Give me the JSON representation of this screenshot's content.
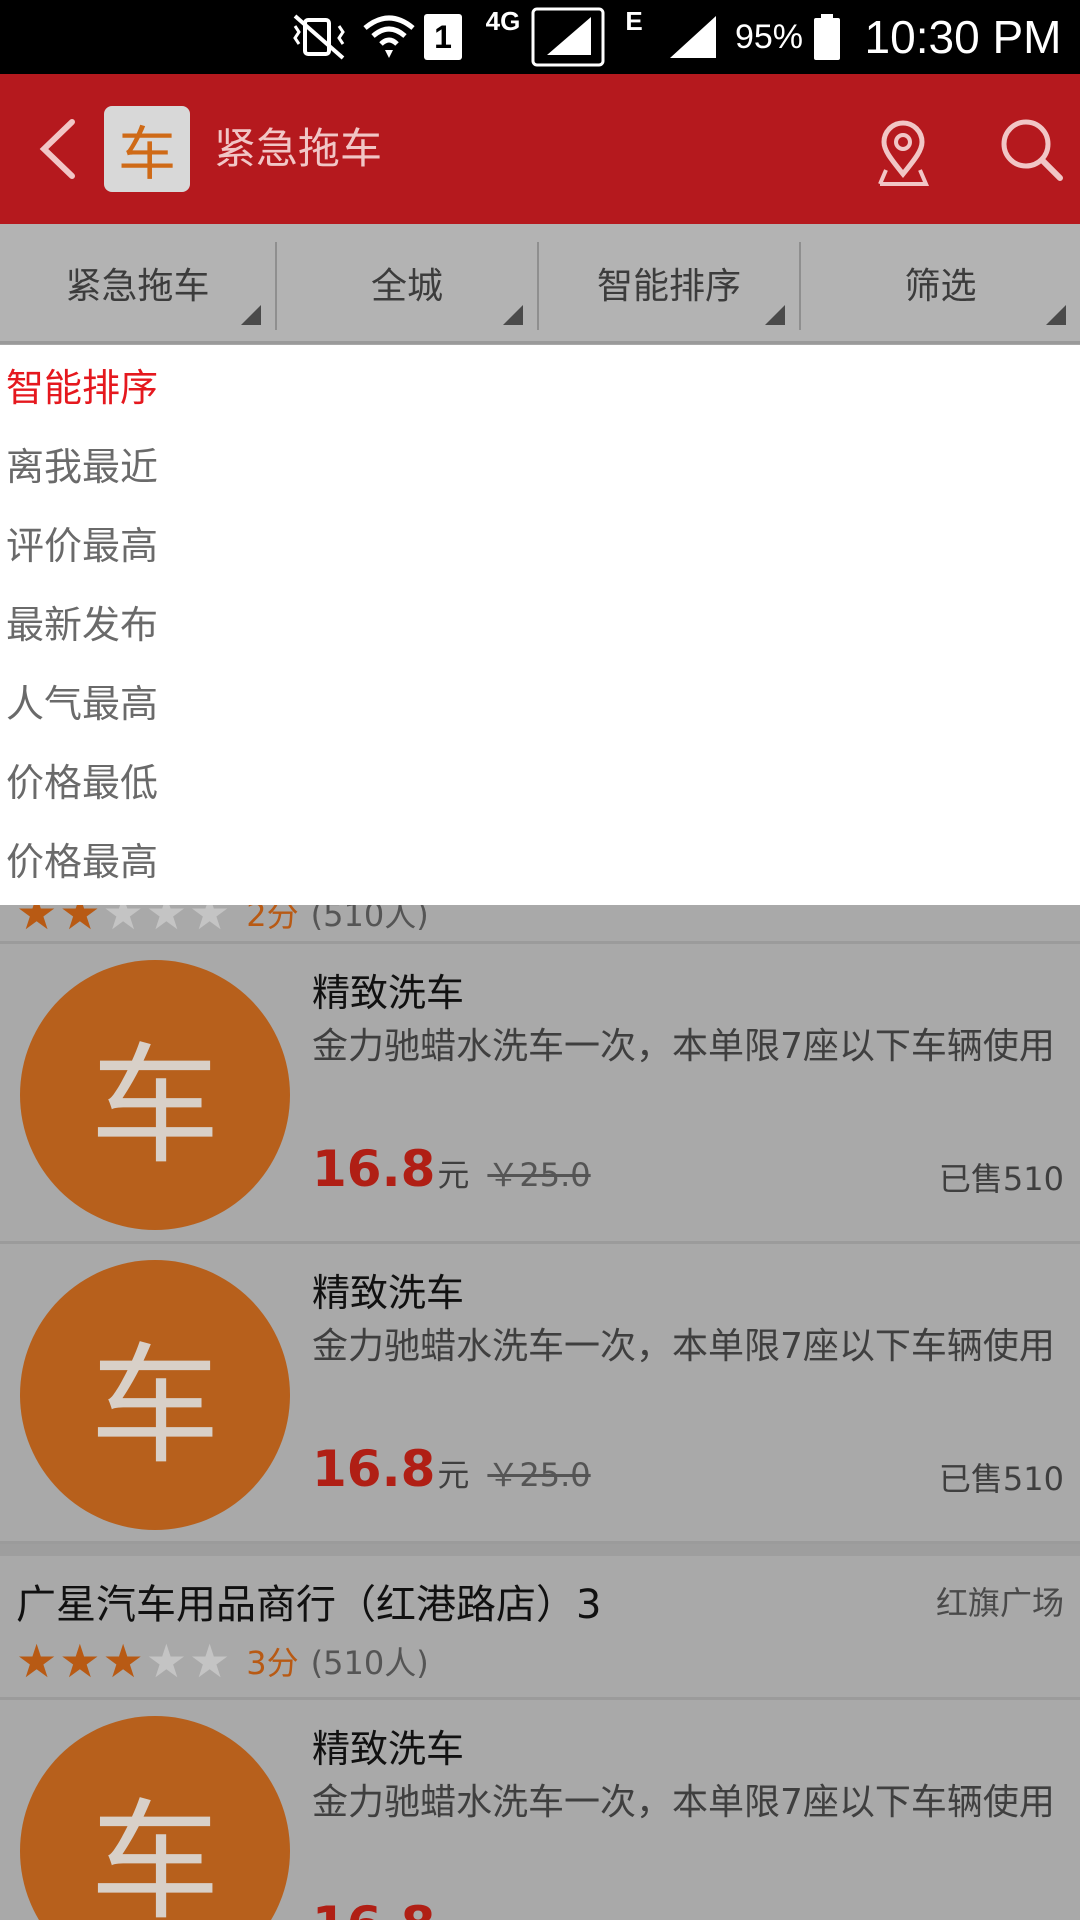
{
  "status_bar": {
    "signal_label": "1",
    "network_4g": "4G",
    "network_e": "E",
    "battery": "95%",
    "time": "10:30 PM"
  },
  "app_bar": {
    "logo_char": "车",
    "title": "紧急拖车"
  },
  "filters": [
    {
      "label": "紧急拖车"
    },
    {
      "label": "全城"
    },
    {
      "label": "智能排序"
    },
    {
      "label": "筛选"
    }
  ],
  "sort_menu": {
    "items": [
      "智能排序",
      "离我最近",
      "评价最高",
      "最新发布",
      "人气最高",
      "价格最低",
      "价格最高"
    ],
    "selected": "智能排序"
  },
  "partial_shop": {
    "stars": 2,
    "score": "2分",
    "count": "(510人)"
  },
  "cards": [
    {
      "thumb_char": "车",
      "title": "精致洗车",
      "desc": "金力驰蜡水洗车一次，本单限7座以下车辆使用",
      "price": "16.8",
      "unit": "元",
      "original": "￥25.0",
      "sold": "已售510"
    },
    {
      "thumb_char": "车",
      "title": "精致洗车",
      "desc": "金力驰蜡水洗车一次，本单限7座以下车辆使用",
      "price": "16.8",
      "unit": "元",
      "original": "￥25.0",
      "sold": "已售510"
    }
  ],
  "shop": {
    "name": "广星汽车用品商行（红港路店）3",
    "area": "红旗广场",
    "stars": 3,
    "score": "3分",
    "count": "(510人)"
  },
  "bottom_card": {
    "thumb_char": "车",
    "title": "精致洗车",
    "desc": "金力驰蜡水洗车一次，本单限7座以下车辆使用",
    "price": "16.8"
  },
  "colors": {
    "brand_red": "#b5191e",
    "active_red": "#e5181e",
    "price_red": "#b01f15",
    "thumb_orange": "#b7601c"
  }
}
